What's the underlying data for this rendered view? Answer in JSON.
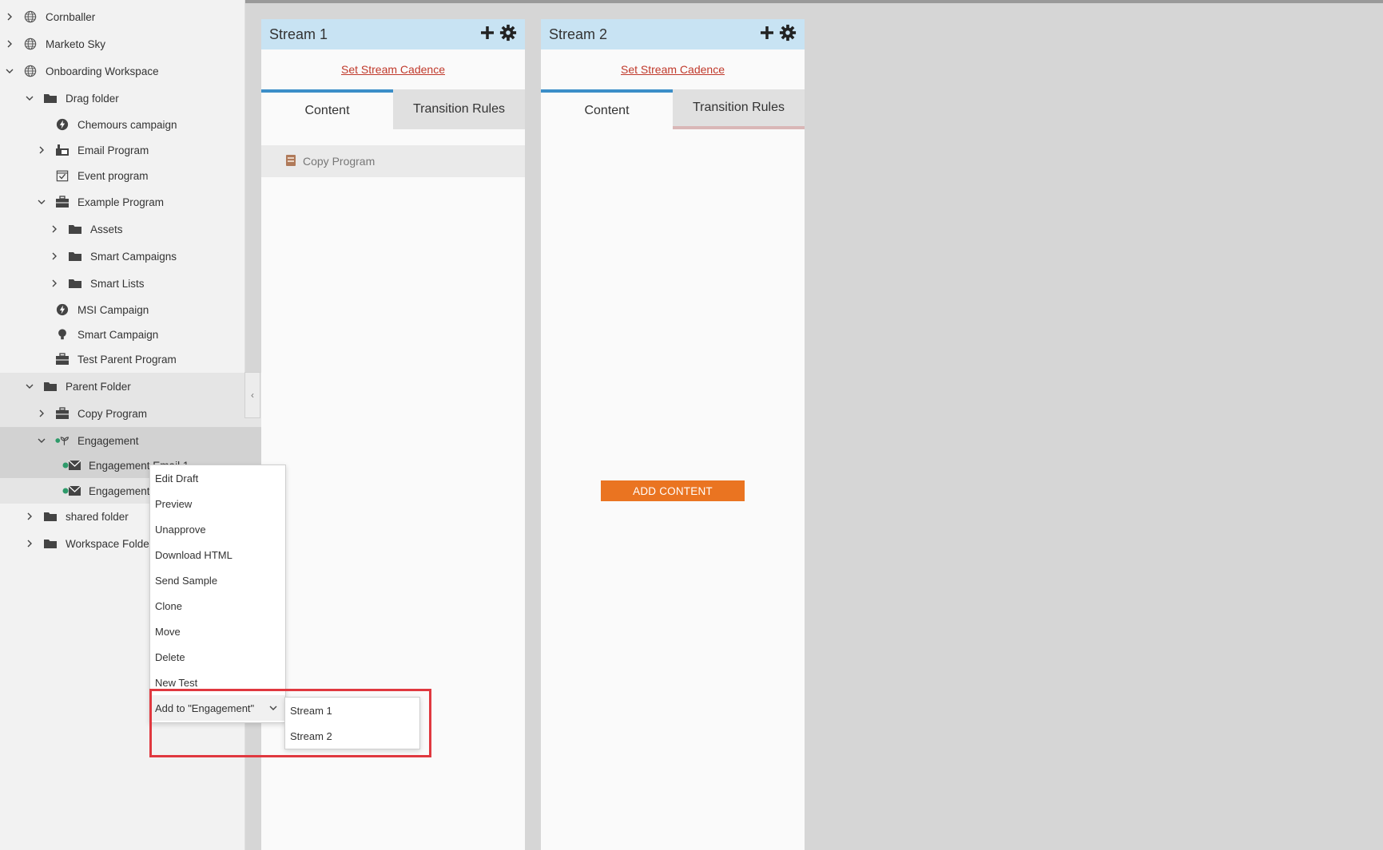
{
  "tree": [
    {
      "label": "Cornballer",
      "chevron": "right",
      "icon": "globe-icon"
    },
    {
      "label": "Marketo Sky",
      "chevron": "right",
      "icon": "globe-icon"
    },
    {
      "label": "Onboarding Workspace",
      "chevron": "down",
      "icon": "globe-icon"
    },
    {
      "label": "Drag folder",
      "chevron": "down",
      "icon": "folder-icon"
    },
    {
      "label": "Chemours campaign",
      "chevron": "",
      "icon": "bolt-icon"
    },
    {
      "label": "Email Program",
      "chevron": "right",
      "icon": "email-program-icon"
    },
    {
      "label": "Event program",
      "chevron": "",
      "icon": "calendar-check-icon"
    },
    {
      "label": "Example Program",
      "chevron": "down",
      "icon": "briefcase-icon"
    },
    {
      "label": "Assets",
      "chevron": "right",
      "icon": "folder-icon"
    },
    {
      "label": "Smart Campaigns",
      "chevron": "right",
      "icon": "folder-icon"
    },
    {
      "label": "Smart Lists",
      "chevron": "right",
      "icon": "folder-icon"
    },
    {
      "label": "MSI Campaign",
      "chevron": "",
      "icon": "bolt-icon"
    },
    {
      "label": "Smart Campaign",
      "chevron": "",
      "icon": "lightbulb-icon"
    },
    {
      "label": "Test Parent Program",
      "chevron": "",
      "icon": "briefcase-icon"
    },
    {
      "label": "Parent Folder",
      "chevron": "down",
      "icon": "folder-icon"
    },
    {
      "label": "Copy Program",
      "chevron": "right",
      "icon": "briefcase-icon"
    },
    {
      "label": "Engagement",
      "chevron": "down",
      "icon": "engagement-icon"
    },
    {
      "label": "Engagement Email 1",
      "chevron": "",
      "icon": "email-icon"
    },
    {
      "label": "Engagement Email 2",
      "chevron": "",
      "icon": "email-icon"
    },
    {
      "label": "shared folder",
      "chevron": "right",
      "icon": "folder-icon"
    },
    {
      "label": "Workspace Folder",
      "chevron": "right",
      "icon": "folder-icon"
    }
  ],
  "streams": [
    {
      "title": "Stream 1",
      "cadence": "Set Stream Cadence",
      "tabs": [
        "Content",
        "Transition Rules"
      ],
      "content_item": "Copy Program"
    },
    {
      "title": "Stream 2",
      "cadence": "Set Stream Cadence",
      "tabs": [
        "Content",
        "Transition Rules"
      ],
      "add_button": "ADD CONTENT"
    }
  ],
  "context_menu": {
    "items": [
      "Edit Draft",
      "Preview",
      "Unapprove",
      "Download HTML",
      "Send Sample",
      "Clone",
      "Move",
      "Delete",
      "New Test"
    ],
    "add_to": "Add to \"Engagement\"",
    "submenu": [
      "Stream 1",
      "Stream 2"
    ]
  },
  "colors": {
    "accent": "#3b8ec8",
    "stream_header": "#c8e3f3",
    "add_button": "#ea7421",
    "highlight_box": "#e0383f",
    "link": "#c0392b"
  }
}
